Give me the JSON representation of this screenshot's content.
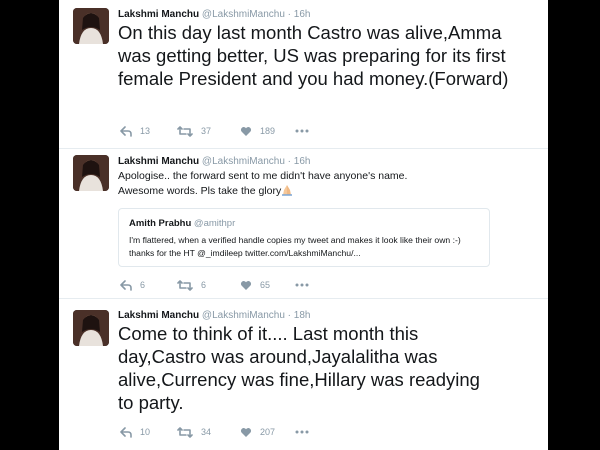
{
  "icons": {
    "reply": "reply-icon",
    "retweet": "retweet-icon",
    "like": "heart-icon",
    "more": "more-dots-icon",
    "praying_hands": "praying-hands-emoji"
  },
  "tweets": [
    {
      "name": "Lakshmi Manchu",
      "handle": "@LakshmiManchu",
      "sep": "·",
      "time": "16h",
      "text": "On this day last month Castro was alive,Amma was getting better, US was preparing for its first female President and you had money.(Forward)",
      "replies": "13",
      "retweets": "37",
      "likes": "189"
    },
    {
      "name": "Lakshmi Manchu",
      "handle": "@LakshmiManchu",
      "sep": "·",
      "time": "16h",
      "text_line1": "Apologise.. the forward sent to me  didn't have anyone's name.",
      "text_line2": "Awesome words. Pls take the glory",
      "quote": {
        "name": "Amith Prabhu",
        "handle": "@amithpr",
        "text": "I'm flattered, when a verified handle copies my tweet and makes it look like their own :-) thanks for the  HT @_imdileep twitter.com/LakshmiManchu/..."
      },
      "replies": "6",
      "retweets": "6",
      "likes": "65"
    },
    {
      "name": "Lakshmi Manchu",
      "handle": "@LakshmiManchu",
      "sep": "·",
      "time": "18h",
      "text": "Come to think of it.... Last month this day,Castro was around,Jayalalitha was alive,Currency was fine,Hillary was readying to party.",
      "replies": "10",
      "retweets": "34",
      "likes": "207"
    }
  ]
}
